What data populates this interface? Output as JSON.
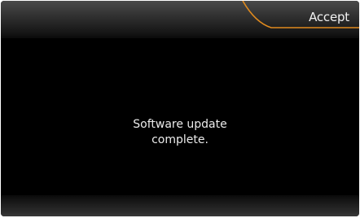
{
  "header": {
    "accept_label": "Accept"
  },
  "message": {
    "line1": "Software update",
    "line2": "complete."
  },
  "colors": {
    "background": "#000000",
    "accent": "#e08a1e",
    "text": "#ececec"
  }
}
